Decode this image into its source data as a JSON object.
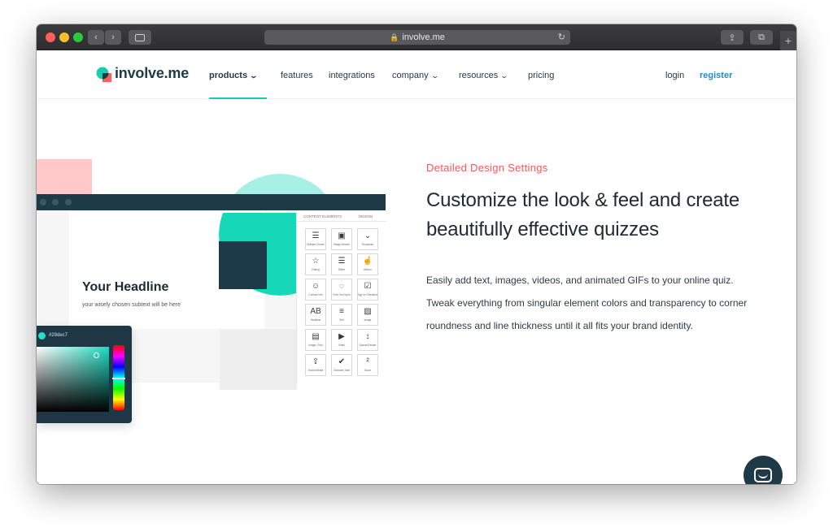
{
  "browser": {
    "url": "involve.me",
    "lock_icon": "lock-icon",
    "reload_icon": "reload-icon"
  },
  "nav": {
    "logo_text": "involve.me",
    "items": [
      {
        "label": "products",
        "has_dropdown": true,
        "active": true
      },
      {
        "label": "features",
        "has_dropdown": false
      },
      {
        "label": "integrations",
        "has_dropdown": false
      },
      {
        "label": "company",
        "has_dropdown": true
      },
      {
        "label": "resources",
        "has_dropdown": true
      },
      {
        "label": "pricing",
        "has_dropdown": false
      }
    ],
    "login": "login",
    "register": "register",
    "accent_color": "#17cfb0",
    "register_color": "#1a8ec9"
  },
  "mockup": {
    "headline": "Your Headline",
    "subtext": "your wisely chosen subtext  will be here",
    "panel_tabs": [
      "CONTENT ELEMENTS",
      "DESIGN"
    ],
    "elements": [
      {
        "label": "Multiple Choice",
        "icon": "☰"
      },
      {
        "label": "Image Answer",
        "icon": "▣"
      },
      {
        "label": "Dropdown",
        "icon": "⌄"
      },
      {
        "label": "Rating",
        "icon": "☆"
      },
      {
        "label": "Slider",
        "icon": "☰"
      },
      {
        "label": "Button",
        "icon": "☝"
      },
      {
        "label": "Contact Info",
        "icon": "☺"
      },
      {
        "label": "Free Text Input",
        "icon": "◌"
      },
      {
        "label": "Sign In Checkbox",
        "icon": "☑"
      },
      {
        "label": "Headline",
        "icon": "AB"
      },
      {
        "label": "Text",
        "icon": "≡"
      },
      {
        "label": "Image",
        "icon": "▨"
      },
      {
        "label": "Image / Text",
        "icon": "▤"
      },
      {
        "label": "Video",
        "icon": "▶"
      },
      {
        "label": "Spacer/Divider",
        "icon": "↕"
      },
      {
        "label": "Social Media",
        "icon": "⇪"
      },
      {
        "label": "Outcome Vote",
        "icon": "✔"
      },
      {
        "label": "Score",
        "icon": "²"
      }
    ],
    "color_picker": {
      "hex": "#29dec7",
      "swatch_color": "#29dec7"
    }
  },
  "content": {
    "eyebrow": "Detailed Design Settings",
    "title": "Customize the look & feel and create beautifully effective quizzes",
    "body": "Easily add text, images, videos, and animated GIFs to your online quiz. Tweak everything from singular element colors and transparency to corner roundness and line thickness until it all fits your brand identity.",
    "eyebrow_color": "#f25a5a"
  },
  "chat": {
    "icon": "chat-icon"
  }
}
